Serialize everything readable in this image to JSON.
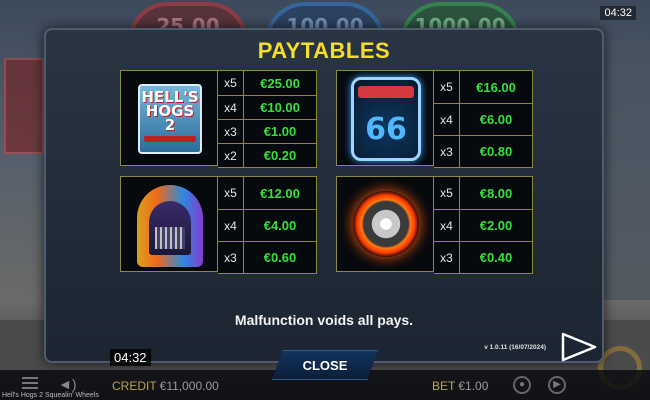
{
  "background": {
    "jackpots": [
      "25.00",
      "100.00",
      "1000.00"
    ],
    "clock_top": "04:32"
  },
  "paytables": {
    "title": "PAYTABLES",
    "cards": [
      {
        "symbol": "hells-hogs-logo-symbol",
        "logo_lines": [
          "HELL'S",
          "HOGS 2"
        ],
        "pays": [
          {
            "mult": "x5",
            "value": "€25.00"
          },
          {
            "mult": "x4",
            "value": "€10.00"
          },
          {
            "mult": "x3",
            "value": "€1.00"
          },
          {
            "mult": "x2",
            "value": "€0.20"
          }
        ]
      },
      {
        "symbol": "route-66-shield-symbol",
        "badge": "66",
        "pays": [
          {
            "mult": "x5",
            "value": "€16.00"
          },
          {
            "mult": "x4",
            "value": "€6.00"
          },
          {
            "mult": "x3",
            "value": "€0.80"
          }
        ]
      },
      {
        "symbol": "jukebox-symbol",
        "pays": [
          {
            "mult": "x5",
            "value": "€12.00"
          },
          {
            "mult": "x4",
            "value": "€4.00"
          },
          {
            "mult": "x3",
            "value": "€0.60"
          }
        ]
      },
      {
        "symbol": "flaming-wheel-symbol",
        "pays": [
          {
            "mult": "x5",
            "value": "€8.00"
          },
          {
            "mult": "x4",
            "value": "€2.00"
          },
          {
            "mult": "x3",
            "value": "€0.40"
          }
        ]
      }
    ],
    "notice": "Malfunction voids all pays.",
    "version": "v 1.0.11 (16/07/2024)",
    "close_label": "CLOSE"
  },
  "clock_bottom": "04:32",
  "status_bar": {
    "credit_label": "CREDIT",
    "credit_value": "€11,000.00",
    "bet_label": "BET",
    "bet_value": "€1.00",
    "game_title": "Hell's Hogs 2 Squealin' Wheels"
  },
  "colors": {
    "title": "#f5dd2a",
    "pay_value": "#36e03a",
    "panel": "#1c2531"
  }
}
